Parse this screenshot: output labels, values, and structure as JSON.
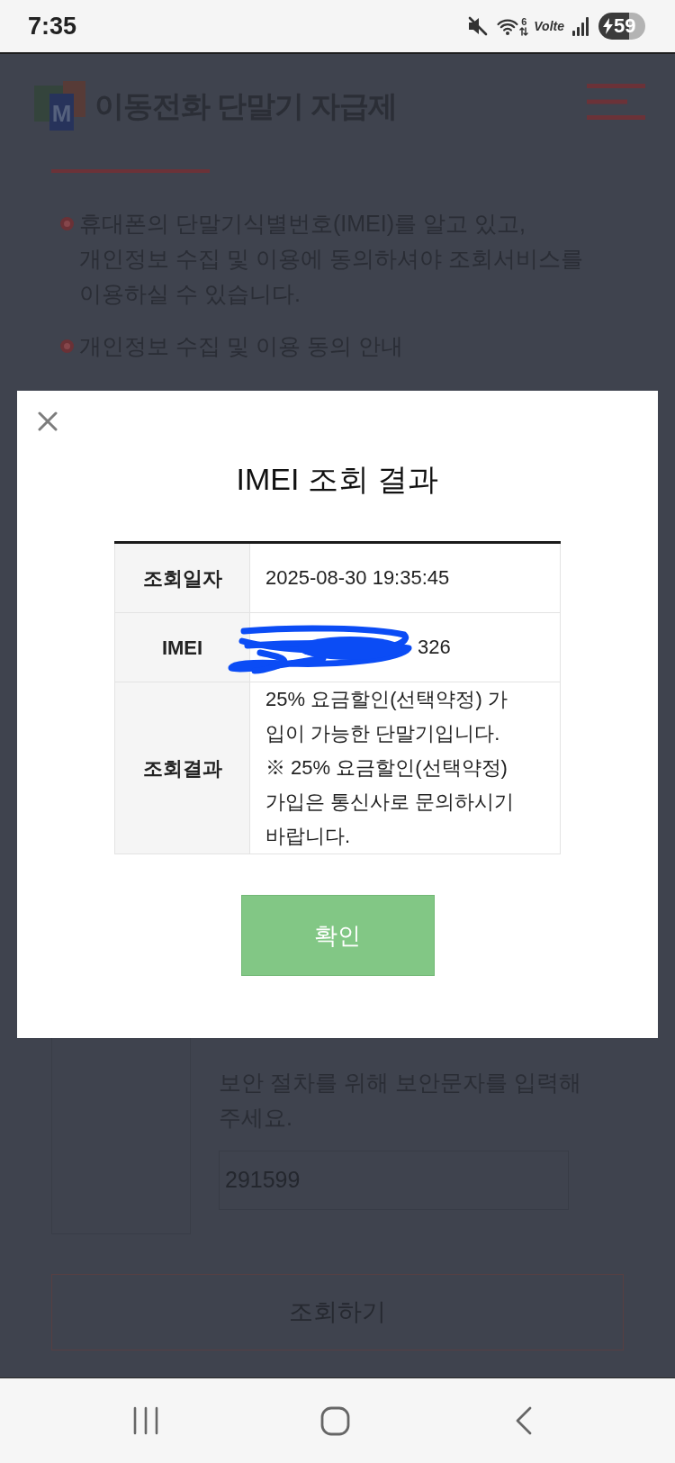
{
  "status_bar": {
    "time": "7:35",
    "wifi_label": "6",
    "network_label": "Volte",
    "battery": "59"
  },
  "page": {
    "title": "이동전화 단말기 자급제",
    "logo_letter": "M",
    "notices": [
      "휴대폰의 단말기식별번호(IMEI)를 알고 있고, 개인정보 수집 및 이용에 동의하셔야 조회서비스를 이용하실 수 있습니다.",
      "개인정보 수집 및 이용 동의 안내"
    ],
    "captcha": {
      "instruction": "보안 절차를 위해 보안문자를 입력해 주세요.",
      "value": "291599"
    },
    "submit_button": "조회하기"
  },
  "dialog": {
    "title": "IMEI 조회 결과",
    "rows": [
      {
        "kind": "plain",
        "label": "조회일자",
        "value": "2025-08-30 19:35:45"
      },
      {
        "kind": "scribbled",
        "label": "IMEI",
        "value": "326"
      },
      {
        "kind": "plain",
        "label": "조회결과",
        "value": "25% 요금할인(선택약정) 가입이 가능한 단말기입니다.\n※ 25% 요금할인(선택약정) 가입은 통신사로 문의하시기 바랍니다."
      }
    ],
    "confirm_button": "확인"
  }
}
